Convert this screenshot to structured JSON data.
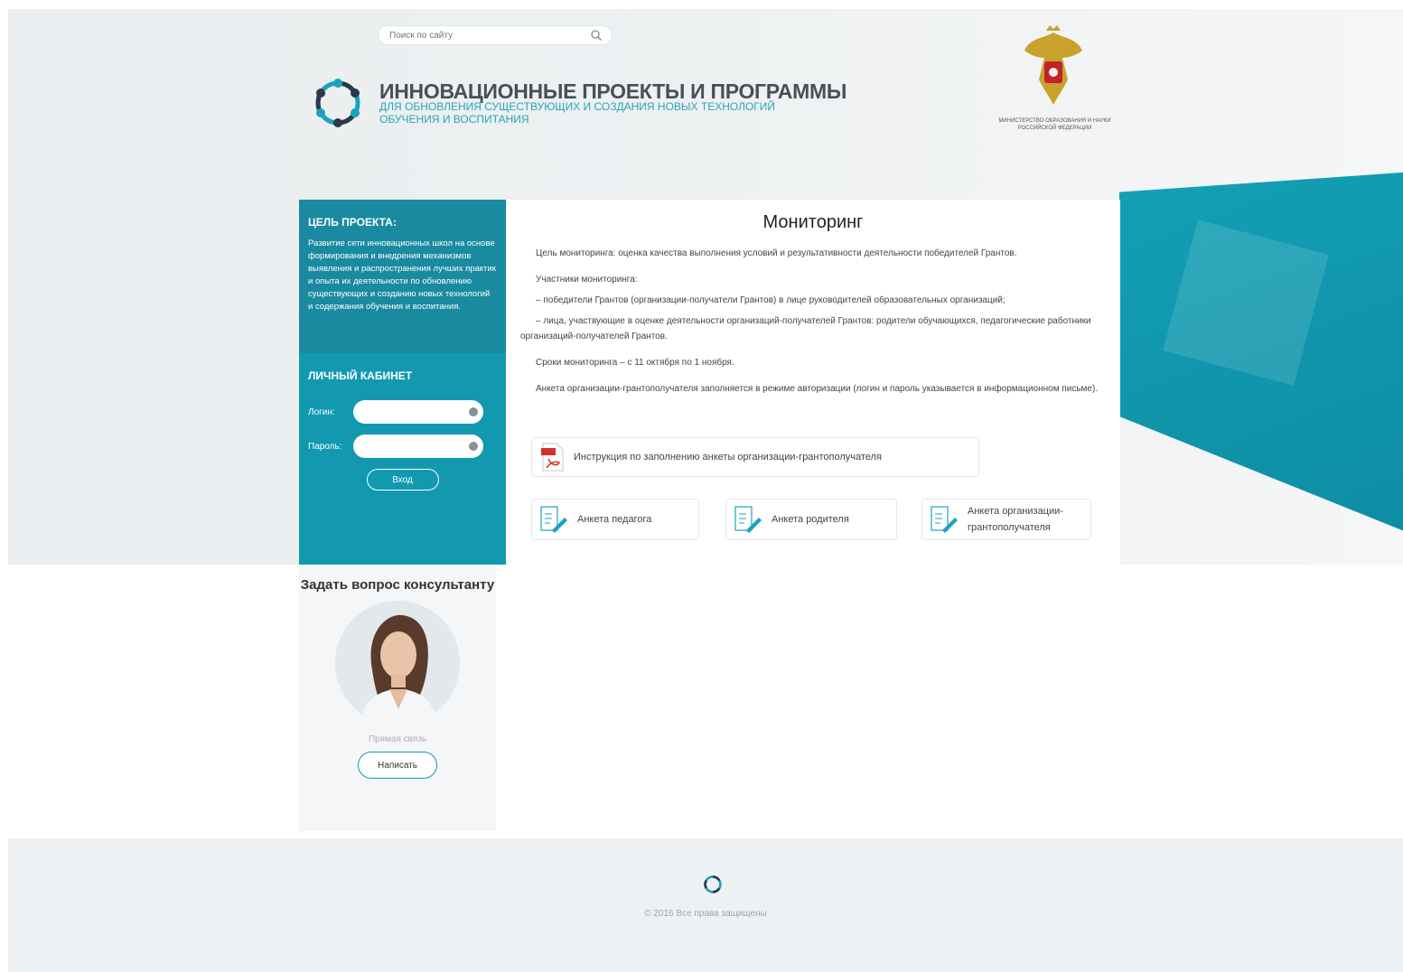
{
  "header": {
    "search_placeholder": "Поиск по сайту",
    "title": "ИННОВАЦИОННЫЕ ПРОЕКТЫ И ПРОГРАММЫ",
    "subtitle": "ДЛЯ ОБНОВЛЕНИЯ СУЩЕСТВУЮЩИХ И СОЗДАНИЯ НОВЫХ ТЕХНОЛОГИЙ ОБУЧЕНИЯ И ВОСПИТАНИЯ",
    "ministry_caption": "МИНИСТЕРСТВО ОБРАЗОВАНИЯ И НАУКИ РОССИЙСКОЙ ФЕДЕРАЦИИ"
  },
  "sidebar": {
    "goal_title": "ЦЕЛЬ ПРОЕКТА:",
    "goal_text": "Развитие сети инновационных школ на основе формирования и внедрения механизмов выявления и распространения лучших практик и опыта их деятельности по обновлению существующих и созданию новых технологий и содержания обучения и воспитания.",
    "cabinet_title": "ЛИЧНЫЙ КАБИНЕТ",
    "login_label": "Логин:",
    "password_label": "Пароль:",
    "login_button": "Вход"
  },
  "main": {
    "title": "Мониторинг",
    "paragraphs": [
      "Цель мониторинга: оценка качества выполнения условий и результативности деятельности победителей Грантов.",
      "Участники мониторинга:",
      "– победители Грантов (организации-получатели Грантов) в лице руководителей образовательных организаций;",
      "– лица, участвующие в оценке деятельности организаций-получателей Грантов: родители обучающихся, педагогические работники организаций-получателей Грантов.",
      "Сроки мониторинга – с 11 октября по 1 ноября.",
      "Анкета организации-грантополучателя заполняется в режиме авторизации (логин и пароль указывается в информационном письме)."
    ],
    "pdf_link": "Инструкция по заполнению анкеты организации-грантополучателя",
    "forms": [
      "Анкета педагога",
      "Анкета родителя",
      "Анкета организации-грантополучателя"
    ]
  },
  "consult": {
    "title": "Задать вопрос консультанту",
    "direct_link": "Прямая связь",
    "write_button": "Написать"
  },
  "footer": {
    "copyright": "© 2016 Все права защищены"
  },
  "colors": {
    "accent": "#1299b0",
    "accent_dark": "#1a8aa0",
    "title_gray": "#4a4f57",
    "subtitle_teal": "#28a4b8"
  }
}
